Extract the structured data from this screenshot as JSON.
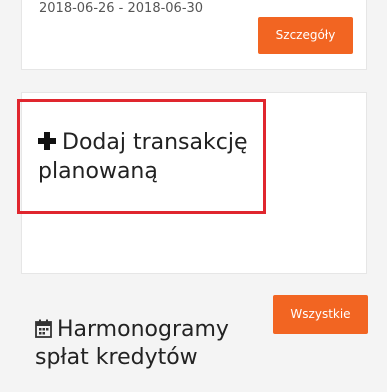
{
  "top_card": {
    "date_range": "2018-06-26 - 2018-06-30",
    "details_button": "Szczegóły"
  },
  "planned_transaction": {
    "icon": "plus-icon",
    "label": "Dodaj transakcję planowaną"
  },
  "loan_schedules": {
    "icon": "calendar-icon",
    "title": "Harmonogramy spłat kredytów",
    "all_button": "Wszystkie"
  },
  "colors": {
    "accent": "#f26522",
    "highlight": "#e0262e",
    "background": "#f4f4f4",
    "card": "#ffffff"
  }
}
